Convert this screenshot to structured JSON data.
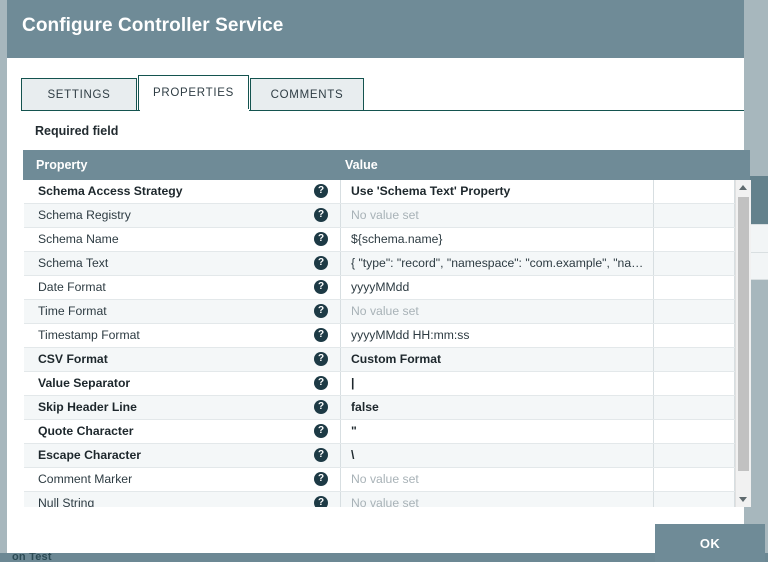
{
  "dialog": {
    "title": "Configure Controller Service",
    "required_field_label": "Required field",
    "ok_label": "OK"
  },
  "tabs": [
    {
      "label": "SETTINGS",
      "active": false
    },
    {
      "label": "PROPERTIES",
      "active": true
    },
    {
      "label": "COMMENTS",
      "active": false
    }
  ],
  "table": {
    "columns": {
      "property": "Property",
      "value": "Value"
    },
    "help_icon_glyph": "?",
    "rows": [
      {
        "property": "Schema Access Strategy",
        "required": true,
        "value": "Use 'Schema Text' Property",
        "value_is_placeholder": false
      },
      {
        "property": "Schema Registry",
        "required": false,
        "value": "No value set",
        "value_is_placeholder": true
      },
      {
        "property": "Schema Name",
        "required": false,
        "value": "${schema.name}",
        "value_is_placeholder": false
      },
      {
        "property": "Schema Text",
        "required": false,
        "value": "{ \"type\": \"record\", \"namespace\": \"com.example\", \"name\": …",
        "value_is_placeholder": false
      },
      {
        "property": "Date Format",
        "required": false,
        "value": "yyyyMMdd",
        "value_is_placeholder": false
      },
      {
        "property": "Time Format",
        "required": false,
        "value": "No value set",
        "value_is_placeholder": true
      },
      {
        "property": "Timestamp Format",
        "required": false,
        "value": "yyyyMMdd HH:mm:ss",
        "value_is_placeholder": false
      },
      {
        "property": "CSV Format",
        "required": true,
        "value": "Custom Format",
        "value_is_placeholder": false
      },
      {
        "property": "Value Separator",
        "required": true,
        "value": "|",
        "value_is_placeholder": false
      },
      {
        "property": "Skip Header Line",
        "required": true,
        "value": "false",
        "value_is_placeholder": false
      },
      {
        "property": "Quote Character",
        "required": true,
        "value": "\"",
        "value_is_placeholder": false
      },
      {
        "property": "Escape Character",
        "required": true,
        "value": "\\",
        "value_is_placeholder": false
      },
      {
        "property": "Comment Marker",
        "required": false,
        "value": "No value set",
        "value_is_placeholder": true
      },
      {
        "property": "Null String",
        "required": false,
        "value": "No value set",
        "value_is_placeholder": true
      }
    ]
  },
  "background": {
    "bottom_text": "on Test"
  },
  "colors": {
    "titlebar": "#6f8b97",
    "table_header": "#6f8b97",
    "tab_border": "#14534f",
    "row_alt": "#f4f7f8",
    "placeholder_text": "#a8b2b7",
    "help_icon": "#1d3a45",
    "backdrop_strip": "#a7b7bd"
  }
}
